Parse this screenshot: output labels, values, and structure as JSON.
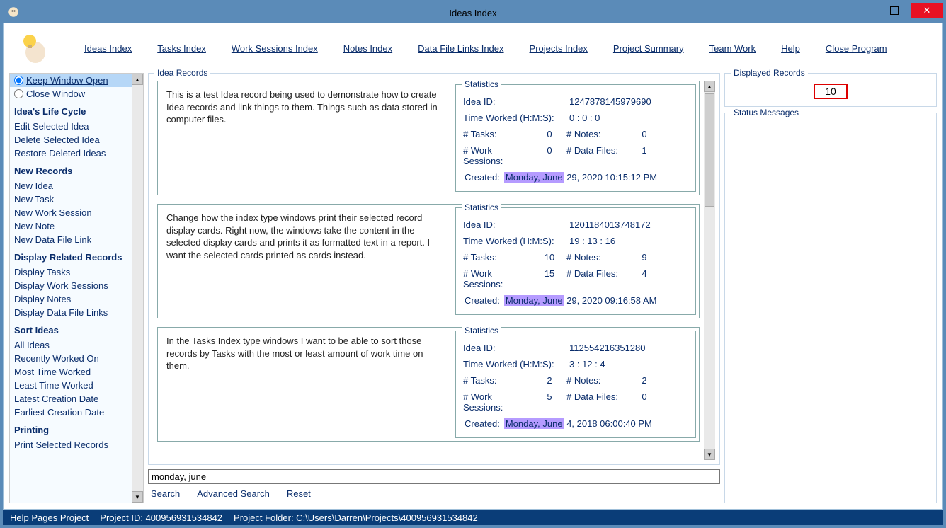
{
  "window": {
    "title": "Ideas Index"
  },
  "menu": {
    "items": [
      "Ideas Index",
      "Tasks Index",
      "Work Sessions Index",
      "Notes Index",
      "Data File Links Index",
      "Projects Index",
      "Project Summary",
      "Team Work",
      "Help",
      "Close Program"
    ]
  },
  "sidebar": {
    "radio": {
      "keep": "Keep Window Open",
      "close": "Close Window"
    },
    "sections": [
      {
        "title": "Idea's Life Cycle",
        "items": [
          "Edit Selected Idea",
          "Delete Selected Idea",
          "Restore Deleted Ideas"
        ]
      },
      {
        "title": "New Records",
        "items": [
          "New Idea",
          "New Task",
          "New Work Session",
          "New Note",
          "New Data File Link"
        ]
      },
      {
        "title": "Display Related Records",
        "items": [
          "Display Tasks",
          "Display Work Sessions",
          "Display Notes",
          "Display Data File Links"
        ]
      },
      {
        "title": "Sort Ideas",
        "items": [
          "All Ideas",
          "Recently Worked On",
          "Most Time Worked",
          "Least Time Worked",
          "Latest Creation Date",
          "Earliest Creation Date"
        ]
      },
      {
        "title": "Printing",
        "items": [
          "Print Selected Records"
        ]
      }
    ]
  },
  "records_legend": "Idea Records",
  "stats_legend": "Statistics",
  "labels": {
    "idea_id": "Idea ID:",
    "time_worked": "Time Worked (H:M:S):",
    "tasks": "# Tasks:",
    "notes": "# Notes:",
    "work_sessions": "# Work Sessions:",
    "data_files": "# Data Files:",
    "created": "Created:"
  },
  "records": [
    {
      "desc": "This is a test Idea record being used to demonstrate how to create Idea records and link things to them. Things such as data stored in computer files.",
      "idea_id": "1247878145979690",
      "time_worked": "0  :  0   :  0",
      "tasks": "0",
      "notes": "0",
      "work_sessions": "0",
      "data_files": "1",
      "created_hl": "Monday, June",
      "created_rest": " 29, 2020   10:15:12 PM"
    },
    {
      "desc": "Change how the index type windows print their selected record display cards. Right now, the windows take the content in the selected display cards and prints it as formatted text in a report. I want the selected cards printed as cards instead.",
      "idea_id": "1201184013748172",
      "time_worked": "19  :  13  :  16",
      "tasks": "10",
      "notes": "9",
      "work_sessions": "15",
      "data_files": "4",
      "created_hl": "Monday, June",
      "created_rest": " 29, 2020   09:16:58 AM"
    },
    {
      "desc": "In the Tasks Index type windows I want to be able to sort those records by Tasks with the most or least amount of work time on them.",
      "idea_id": "112554216351280",
      "time_worked": "3  :  12  :  4",
      "tasks": "2",
      "notes": "2",
      "work_sessions": "5",
      "data_files": "0",
      "created_hl": "Monday, June",
      "created_rest": " 4, 2018   06:00:40 PM"
    }
  ],
  "search": {
    "value": "monday, june",
    "actions": [
      "Search",
      "Advanced Search",
      "Reset"
    ]
  },
  "right": {
    "displayed_legend": "Displayed Records",
    "displayed_count": "10",
    "status_legend": "Status Messages"
  },
  "statusbar": {
    "help": "Help Pages Project",
    "project_id": "Project ID:  400956931534842",
    "project_folder": "Project Folder:  C:\\Users\\Darren\\Projects\\400956931534842"
  }
}
